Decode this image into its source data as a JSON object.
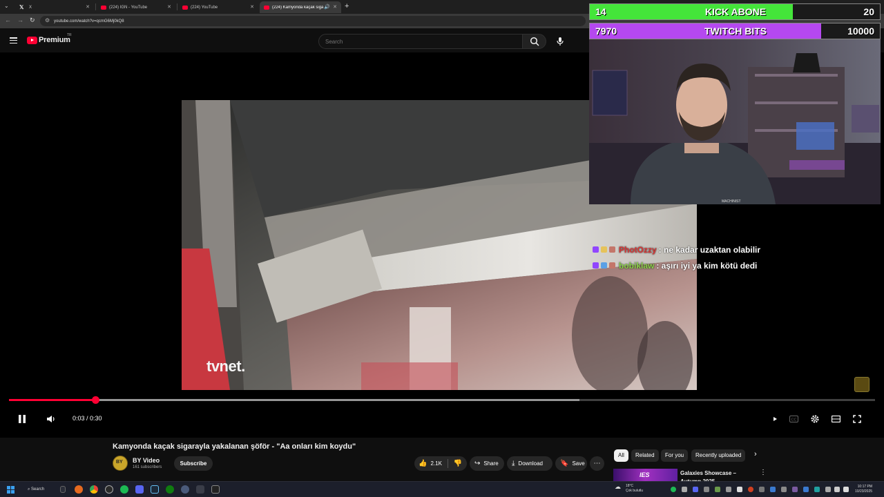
{
  "browser": {
    "tabs": [
      {
        "label": "X",
        "icon": "x-logo-icon"
      },
      {
        "label": "(224) IGN - YouTube",
        "icon": "youtube-icon"
      },
      {
        "label": "(224) YouTube",
        "icon": "youtube-icon"
      },
      {
        "label": "(224) Kamyonda kaçak siga",
        "icon": "youtube-icon"
      }
    ],
    "new_tab": "+",
    "url": "youtube.com/watch?v=qcmG6Mj0kQ8"
  },
  "header": {
    "logo_text": "Premium",
    "logo_country": "TR",
    "search_placeholder": "Search"
  },
  "video": {
    "watermark": "tvnet",
    "time": "0:03 / 0:30",
    "progress": 0.1,
    "chat": [
      {
        "user": "PhotOzzy",
        "message": ": ne kadar uzaktan olabilir",
        "user_color": "#d93636"
      },
      {
        "user": "bobiklaw",
        "message": ": aşırı iyi ya kim kötü dedi",
        "user_color": "#8bd34a"
      }
    ]
  },
  "stream_overlay": {
    "goals": [
      {
        "current": "14",
        "name": "KICK ABONE",
        "target": "20",
        "fraction": 0.7,
        "color": "#44e53a"
      },
      {
        "current": "7970",
        "name": "TWITCH BITS",
        "target": "10000",
        "fraction": 0.797,
        "color": "#b548f0"
      }
    ],
    "webcam_shirt_text": "MACHINIST"
  },
  "watch": {
    "title": "Kamyonda kaçak sigarayla yakalanan şöför - \"Aa onları kim koydu\"",
    "channel": "BY Video",
    "channel_avatar": "BY",
    "subscribers": "161 subscribers",
    "subscribe": "Subscribe",
    "likes": "2.1K",
    "share": "Share",
    "download": "Download",
    "save": "Save"
  },
  "sidebar": {
    "chips": [
      "All",
      "Related",
      "For you",
      "Recently uploaded"
    ],
    "rec_thumb_text": "IES",
    "rec_title": "Galaxies Showcase – Autumn 2025"
  },
  "taskbar": {
    "search": "Search",
    "weather_temp": "18°C",
    "weather_desc": "Çok bulutlu",
    "time": "10:17 PM",
    "date": "10/23/2025"
  }
}
